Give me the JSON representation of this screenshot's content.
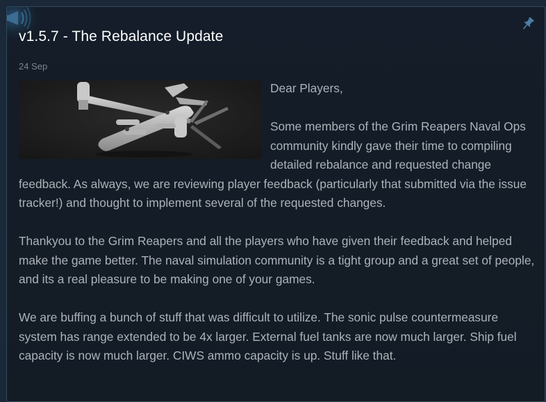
{
  "post": {
    "title": "v1.5.7 - The Rebalance Update",
    "date": "24 Sep",
    "paragraphs": [
      "Dear Players,",
      "Some members of the Grim Reapers Naval Ops community kindly gave their time to compiling detailed rebalance and requested change feedback. As always, we are reviewing player feedback (particularly that submitted via the issue tracker!) and thought to implement several of the requested changes.",
      "Thankyou to the Grim Reapers and all the players who have given their feedback and helped make the game better. The naval simulation community is a tight group and a great set of people, and its a real pleasure to be making one of your games.",
      "We are buffing a bunch of stuff that was difficult to utilize. The sonic pulse countermeasure system has range extended to be 4x larger. External fuel tanks are now much larger. Ship fuel capacity is now much larger. CIWS ammo capacity is up. Stuff like that."
    ]
  },
  "icons": {
    "announcement": "megaphone-icon",
    "pinned": "pin-icon"
  },
  "colors": {
    "background": "#1b2838",
    "card": "#141d29",
    "title": "#ffffff",
    "body_text": "#acb2b8",
    "date": "#7a8591",
    "accent": "#66c0f4"
  }
}
